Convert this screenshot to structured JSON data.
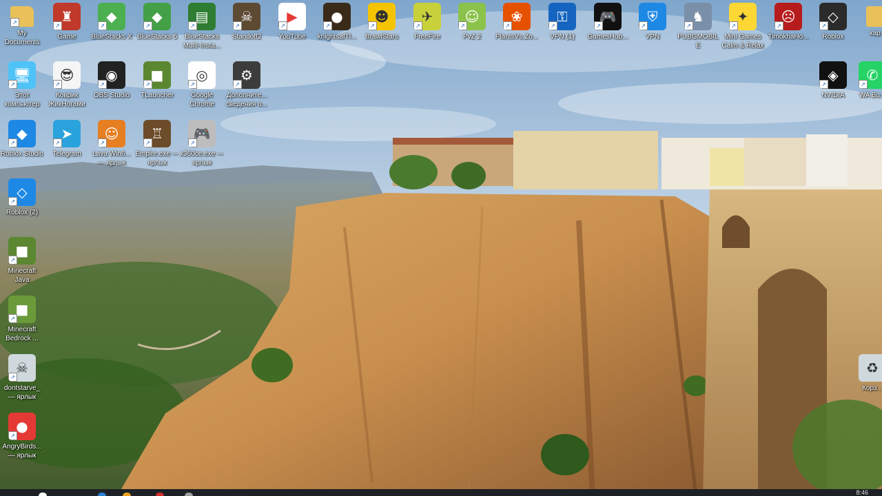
{
  "desktop": {
    "icons": [
      {
        "label": "My Documents",
        "icon": "folder-icon",
        "color": "#e8c15a",
        "glyph": "",
        "shortcut": true
      },
      {
        "label": "Game",
        "icon": "game-icon",
        "color": "#c0392b",
        "glyph": "♜",
        "shortcut": true
      },
      {
        "label": "BlueStacks X",
        "icon": "bluestacks-icon",
        "color": "#4caf50",
        "glyph": "◆",
        "shortcut": true
      },
      {
        "label": "BlueStacks 5",
        "icon": "bluestacks-icon",
        "color": "#43a047",
        "glyph": "◆",
        "shortcut": true
      },
      {
        "label": "BlueStacks Multi-Insta...",
        "icon": "bluestacks-multi-icon",
        "color": "#2e7d32",
        "glyph": "▤",
        "shortcut": true
      },
      {
        "label": "Standoff2",
        "icon": "standoff-icon",
        "color": "#5d4a33",
        "glyph": "☠",
        "shortcut": true
      },
      {
        "label": "YouTube",
        "icon": "youtube-icon",
        "color": "#ffffff",
        "glyph": "▶",
        "shortcut": true
      },
      {
        "label": "knightsafTl...",
        "icon": "game-icon",
        "color": "#3a2a1a",
        "glyph": "●",
        "shortcut": true
      },
      {
        "label": "BrawlStars",
        "icon": "brawlstars-icon",
        "color": "#f5c400",
        "glyph": "☻",
        "shortcut": true
      },
      {
        "label": "FreeFire",
        "icon": "freefire-icon",
        "color": "#c8d13a",
        "glyph": "✈",
        "shortcut": true
      },
      {
        "label": "PvZ 2",
        "icon": "pvz-icon",
        "color": "#8bc34a",
        "glyph": "☺",
        "shortcut": true
      },
      {
        "label": "PlantsVs.Zo...",
        "icon": "pvz-icon",
        "color": "#e65100",
        "glyph": "❀",
        "shortcut": true
      },
      {
        "label": "VPN (1)",
        "icon": "vpn-key-icon",
        "color": "#1565c0",
        "glyph": "⚿",
        "shortcut": true
      },
      {
        "label": "GamesHub...",
        "icon": "gamepad-icon",
        "color": "#111111",
        "glyph": "🎮",
        "shortcut": true
      },
      {
        "label": "VPN",
        "icon": "vpn-shield-icon",
        "color": "#1e88e5",
        "glyph": "⛨",
        "shortcut": true
      },
      {
        "label": "PUBGMOBILE",
        "icon": "pubg-icon",
        "color": "#7a8fa8",
        "glyph": "♞",
        "shortcut": true
      },
      {
        "label": "Mini Games Calm & Relax",
        "icon": "minigames-icon",
        "color": "#fdd835",
        "glyph": "✦",
        "shortcut": true
      },
      {
        "label": "TimokhaHo...",
        "icon": "game-icon",
        "color": "#b71c1c",
        "glyph": "☹",
        "shortcut": true
      },
      {
        "label": "Roblox",
        "icon": "roblox-icon",
        "color": "#2b2b2b",
        "glyph": "◇",
        "shortcut": true
      },
      {
        "label": "кар...",
        "icon": "folder-icon",
        "color": "#e8c15a",
        "glyph": "",
        "shortcut": false
      },
      {
        "label": "Этот компьютер",
        "icon": "computer-icon",
        "color": "#4fc3f7",
        "glyph": "🖥",
        "shortcut": true
      },
      {
        "label": "Коврик ЖикНогами",
        "icon": "mustache-icon",
        "color": "#f5f5f5",
        "glyph": "😎",
        "shortcut": true
      },
      {
        "label": "OBS Studio",
        "icon": "obs-icon",
        "color": "#222222",
        "glyph": "◉",
        "shortcut": true
      },
      {
        "label": "TLauncher",
        "icon": "tlauncher-icon",
        "color": "#5b8731",
        "glyph": "■",
        "shortcut": true
      },
      {
        "label": "Google Chrome",
        "icon": "chrome-icon",
        "color": "#ffffff",
        "glyph": "◎",
        "shortcut": true
      },
      {
        "label": "Дополните... сведения о...",
        "icon": "settings-icon",
        "color": "#3c3c3c",
        "glyph": "⚙",
        "shortcut": true
      },
      {
        "label": "NVIDIA",
        "icon": "nvidia-icon",
        "color": "#111111",
        "glyph": "◈",
        "shortcut": true
      },
      {
        "label": "WA Bu...",
        "icon": "whatsapp-icon",
        "color": "#25d366",
        "glyph": "✆",
        "shortcut": true
      },
      {
        "label": "Roblox Studio",
        "icon": "roblox-studio-icon",
        "color": "#1e88e5",
        "glyph": "◆",
        "shortcut": true
      },
      {
        "label": "Telegram",
        "icon": "telegram-icon",
        "color": "#2aa3dc",
        "glyph": "➤",
        "shortcut": true
      },
      {
        "label": "Lava Win6... — ярлык",
        "icon": "crash-icon",
        "color": "#e67e22",
        "glyph": "☺",
        "shortcut": true
      },
      {
        "label": "Empire.exe — ярлык",
        "icon": "empire-icon",
        "color": "#6d4c2a",
        "glyph": "♖",
        "shortcut": true
      },
      {
        "label": "x360ce.exe — ярлык",
        "icon": "gamepad-icon",
        "color": "#bdbdbd",
        "glyph": "🎮",
        "shortcut": true
      },
      {
        "label": "Roblox (2)",
        "icon": "roblox-icon",
        "color": "#1e88e5",
        "glyph": "◇",
        "shortcut": true
      },
      {
        "label": "Minecraft Java",
        "icon": "minecraft-icon",
        "color": "#5b8731",
        "glyph": "■",
        "shortcut": true
      },
      {
        "label": "Minecraft Bedrock ...",
        "icon": "minecraft-icon",
        "color": "#6b9a3a",
        "glyph": "■",
        "shortcut": true
      },
      {
        "label": "dontstarve_ — ярлык",
        "icon": "dontstarve-icon",
        "color": "#cfd8dc",
        "glyph": "☠",
        "shortcut": true
      },
      {
        "label": "AngryBirds... — ярлык",
        "icon": "angrybirds-icon",
        "color": "#e53935",
        "glyph": "●",
        "shortcut": true
      },
      {
        "label": "Корз...",
        "icon": "recycle-bin-icon",
        "color": "#cfd8dc",
        "glyph": "♻",
        "shortcut": false
      }
    ]
  },
  "taskbar": {
    "time": "8:46"
  }
}
